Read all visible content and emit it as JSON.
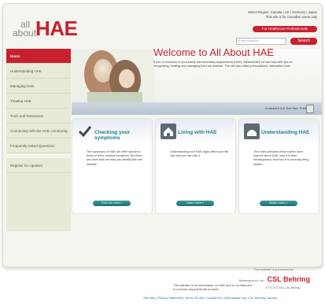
{
  "header": {
    "logo_small_1": "all",
    "logo_small_2": "about",
    "logo_big": "HAE",
    "region_line1": "Select Region: Canada | US | Germany | Japan",
    "region_line2": "This site is for Canadian users only",
    "hcp_button": "For Healthcare Professionals",
    "search_placeholder": "Enter Keyword",
    "search_button": "Search"
  },
  "sidebar": {
    "items": [
      {
        "label": "Home"
      },
      {
        "label": "Understanding HAE"
      },
      {
        "label": "Managing HAE"
      },
      {
        "label": "Treating HAE"
      },
      {
        "label": "Tools and Resources"
      },
      {
        "label": "Connecting with the HAE community"
      },
      {
        "label": "Frequently Asked Questions"
      },
      {
        "label": "Register for Updates"
      }
    ]
  },
  "hero": {
    "title": "Welcome to All About HAE",
    "text": "If you or someone in your family has hereditary angioedema (HAE), AllAboutHAE.ca can help with tips on recognizing, treating and managing this rare disease. The site also offers personalized, interactive tools."
  },
  "toolbar": {
    "contrast_label": "Contrast",
    "text_size_label": "A A A  Text Size",
    "print_label": "Print"
  },
  "cards": [
    {
      "title": "Checking your symptoms",
      "icon": "check-icon",
      "body": "The symptoms of HAE are often similar to those of other medical conditions. But there are clues that can help you identify this rare disease.",
      "button": "Find out more »"
    },
    {
      "title": "Living with HAE",
      "icon": "home-icon",
      "body": "Understanding how HAE might affect your life can help you live with it.",
      "button": "Learn more »"
    },
    {
      "title": "Understanding HAE",
      "icon": "video-icon",
      "body": "This video presents what experts have learned about HAE, why it is often misdiagnosed, and how it is currently being treated.",
      "button": "Watch video »"
    }
  ],
  "footer": {
    "sponsor": "This website is sponsored by",
    "csl_tag": "Biotherapies for Life",
    "csl_name": "CSL Behring",
    "info": "This website is for information on HAE and is not intended to promote any particular product.",
    "code": "ST7C-5 © 2011 CSL Behring",
    "links": "Site Map  |  Privacy Statement  |  Terms Of Use  |  Contact Us  |  HAEcanada.org  |  CSL Behring Canada"
  },
  "colors": {
    "brand_red": "#c8202f",
    "teal": "#1f7f8f",
    "sidebar_bg": "#e6ead6"
  }
}
